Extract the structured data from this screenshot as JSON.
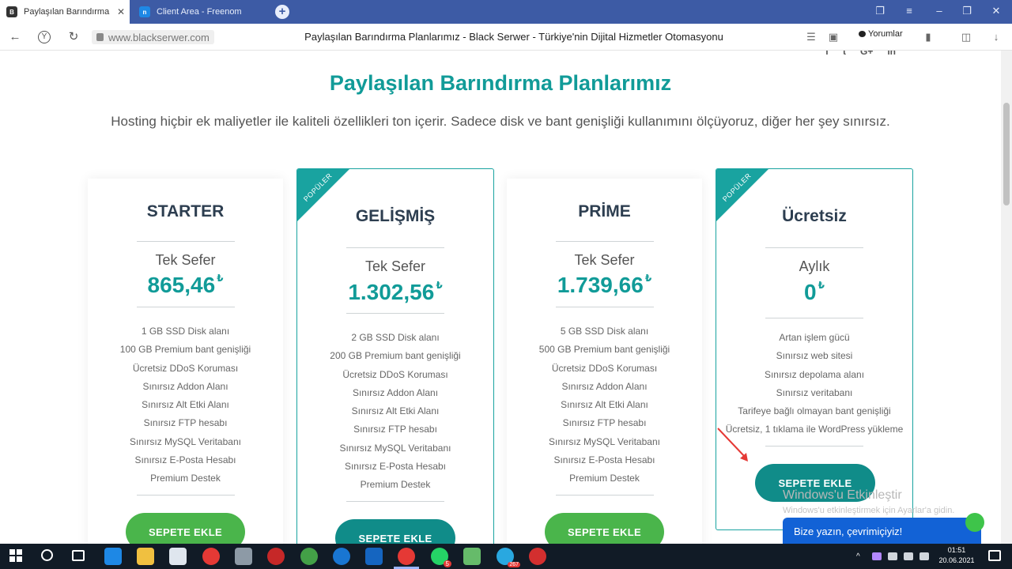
{
  "browser": {
    "tabs": [
      {
        "title": "Paylaşılan Barındırma Pl",
        "favicon": "blackserwer-logo-icon"
      },
      {
        "title": "Client Area - Freenom",
        "favicon": "freenom-logo-icon"
      }
    ],
    "new_tab_label": "+",
    "url": "www.blackserwer.com",
    "page_heading": "Paylaşılan Barındırma Planlarımız - Black Serwer - Türkiye'nin Dijital Hizmetler Otomasyonu",
    "reviews_label": "Yorumlar"
  },
  "page": {
    "social": [
      "f",
      "t",
      "G+",
      "in"
    ],
    "title": "Paylaşılan Barındırma Planlarımız",
    "subtitle": "Hosting hiçbir ek maliyetler ile kaliteli özellikleri ton içerir. Sadece disk ve bant genişliği kullanımını ölçüyoruz, diğer her şey sınırsız.",
    "popular_badge": "POPÜLER",
    "currency": "₺",
    "plans": [
      {
        "name": "STARTER",
        "billing": "Tek Sefer",
        "price": "865,46",
        "popular": false,
        "features": [
          "1 GB SSD Disk alanı",
          "100 GB Premium bant genişliği",
          "Ücretsiz DDoS Koruması",
          "Sınırsız Addon Alanı",
          "Sınırsız Alt Etki Alanı",
          "Sınırsız FTP hesabı",
          "Sınırsız MySQL Veritabanı",
          "Sınırsız E-Posta Hesabı",
          "Premium Destek"
        ],
        "button": "SEPETE EKLE"
      },
      {
        "name": "GELİŞMİŞ",
        "billing": "Tek Sefer",
        "price": "1.302,56",
        "popular": true,
        "features": [
          "2 GB SSD Disk alanı",
          "200 GB Premium bant genişliği",
          "Ücretsiz DDoS Koruması",
          "Sınırsız Addon Alanı",
          "Sınırsız Alt Etki Alanı",
          "Sınırsız FTP hesabı",
          "Sınırsız MySQL Veritabanı",
          "Sınırsız E-Posta Hesabı",
          "Premium Destek"
        ],
        "button": "SEPETE EKLE"
      },
      {
        "name": "PRİME",
        "billing": "Tek Sefer",
        "price": "1.739,66",
        "popular": false,
        "features": [
          "5 GB SSD Disk alanı",
          "500 GB Premium bant genişliği",
          "Ücretsiz DDoS Koruması",
          "Sınırsız Addon Alanı",
          "Sınırsız Alt Etki Alanı",
          "Sınırsız FTP hesabı",
          "Sınırsız MySQL Veritabanı",
          "Sınırsız E-Posta Hesabı",
          "Premium Destek"
        ],
        "button": "SEPETE EKLE"
      },
      {
        "name": "Ücretsiz",
        "billing": "Aylık",
        "price": "0",
        "popular": true,
        "features": [
          "Artan işlem gücü",
          "Sınırsız web sitesi",
          "Sınırsız depolama alanı",
          "Sınırsız veritabanı",
          "Tarifeye bağlı olmayan bant genişliği",
          "Ücretsiz, 1 tıklama ile WordPress yükleme"
        ],
        "button": "SEPETE EKLE"
      }
    ],
    "chat_widget": "Bize yazın, çevrimiçiyiz!",
    "activation_watermark": {
      "title": "Windows'u Etkinleştir",
      "subtitle": "Windows'u etkinleştirmek için Ayarlar'a gidin."
    }
  },
  "taskbar": {
    "time": "01:51",
    "date": "20.06.2021",
    "whatsapp_badge": "5",
    "telegram_badge": "267"
  },
  "colors": {
    "brand_teal": "#119b98",
    "button_green": "#4ab54b",
    "button_teal": "#108c89",
    "tab_bar": "#3d5ba5",
    "chat_blue": "#1262d6"
  }
}
